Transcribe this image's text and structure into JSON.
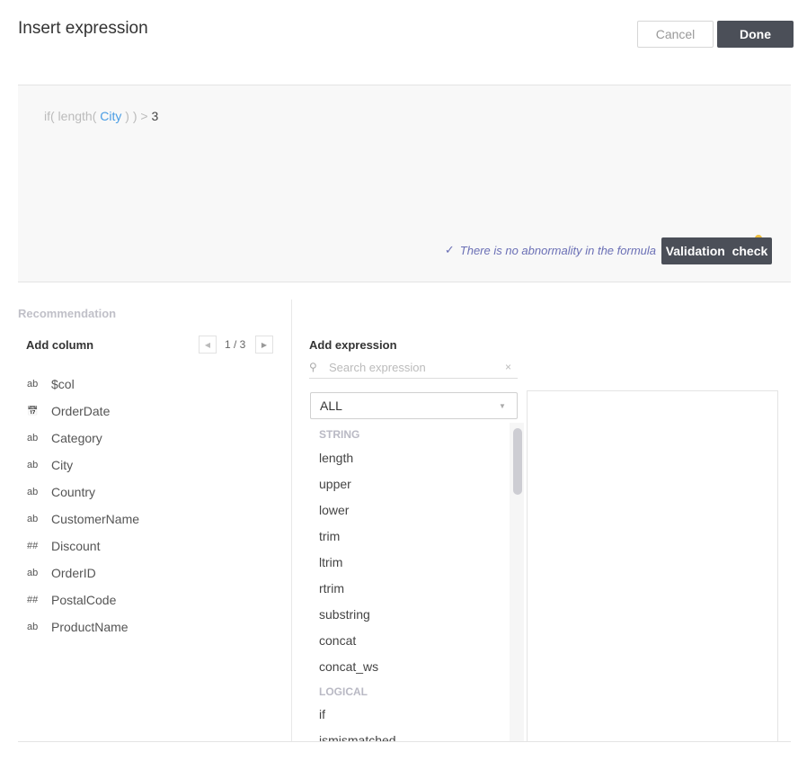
{
  "title": "Insert expression",
  "buttons": {
    "cancel": "Cancel",
    "done": "Done",
    "validate": "Validation  check"
  },
  "formula": {
    "pre": "if( length( ",
    "column": "City",
    "post": " ) ) > ",
    "value": "3"
  },
  "validation_status": "There is no abnormality in the formula",
  "recommendation": "Recommendation",
  "add_column": {
    "heading": "Add column",
    "page": "1 / 3",
    "columns": [
      {
        "type": "ab",
        "name": "$col"
      },
      {
        "type": "calendar",
        "name": "OrderDate"
      },
      {
        "type": "ab",
        "name": "Category"
      },
      {
        "type": "ab",
        "name": "City"
      },
      {
        "type": "ab",
        "name": "Country"
      },
      {
        "type": "ab",
        "name": "CustomerName"
      },
      {
        "type": "##",
        "name": "Discount"
      },
      {
        "type": "ab",
        "name": "OrderID"
      },
      {
        "type": "##",
        "name": "PostalCode"
      },
      {
        "type": "ab",
        "name": "ProductName"
      }
    ]
  },
  "add_expression": {
    "heading": "Add expression",
    "search_placeholder": "Search expression",
    "filter": "ALL",
    "items": [
      {
        "kind": "category",
        "label": "STRING"
      },
      {
        "kind": "fn",
        "label": "length"
      },
      {
        "kind": "fn",
        "label": "upper"
      },
      {
        "kind": "fn",
        "label": "lower"
      },
      {
        "kind": "fn",
        "label": "trim"
      },
      {
        "kind": "fn",
        "label": "ltrim"
      },
      {
        "kind": "fn",
        "label": "rtrim"
      },
      {
        "kind": "fn",
        "label": "substring"
      },
      {
        "kind": "fn",
        "label": "concat"
      },
      {
        "kind": "fn",
        "label": "concat_ws"
      },
      {
        "kind": "category",
        "label": "LOGICAL"
      },
      {
        "kind": "fn",
        "label": "if"
      },
      {
        "kind": "fn",
        "label": "ismismatched"
      }
    ]
  }
}
